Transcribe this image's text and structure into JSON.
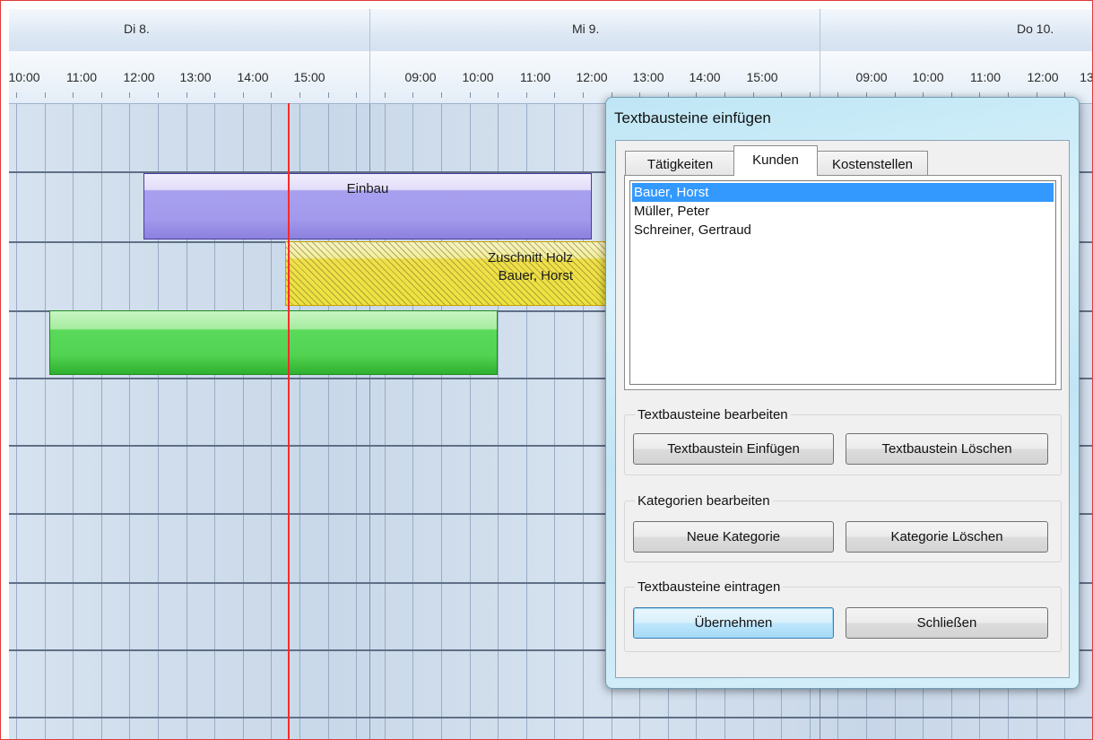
{
  "scheduler": {
    "days": [
      "Di 8.",
      "Mi 9.",
      "Do 10."
    ],
    "times_day1": [
      "10:00",
      "11:00",
      "12:00",
      "13:00",
      "14:00",
      "15:00"
    ],
    "times_day2": [
      "09:00",
      "10:00",
      "11:00",
      "12:00",
      "13:00",
      "14:00",
      "15:00"
    ],
    "times_day3": [
      "09:00",
      "10:00",
      "11:00",
      "12:00",
      "13"
    ],
    "appointments": {
      "einbau": "Einbau",
      "zuschnitt_line1": "Zuschnitt Holz",
      "zuschnitt_line2": "Bauer, Horst"
    },
    "colors": {
      "now_line": "#ff2a2a",
      "einbau": "#a299ec",
      "zuschnitt": "#ede23f",
      "green": "#52d352"
    }
  },
  "dialog": {
    "title": "Textbausteine einfügen",
    "tabs": [
      "Tätigkeiten",
      "Kunden",
      "Kostenstellen"
    ],
    "active_tab": "Kunden",
    "list_items": [
      "Bauer, Horst",
      "Müller, Peter",
      "Schreiner, Gertraud"
    ],
    "selected_item": "Bauer, Horst",
    "group_edit": {
      "title": "Textbausteine bearbeiten",
      "insert_button": "Textbaustein Einfügen",
      "delete_button": "Textbaustein Löschen"
    },
    "group_categories": {
      "title": "Kategorien bearbeiten",
      "new_button": "Neue Kategorie",
      "delete_button": "Kategorie Löschen"
    },
    "group_apply": {
      "title": "Textbausteine eintragen",
      "apply_button": "Übernehmen",
      "close_button": "Schließen"
    }
  }
}
